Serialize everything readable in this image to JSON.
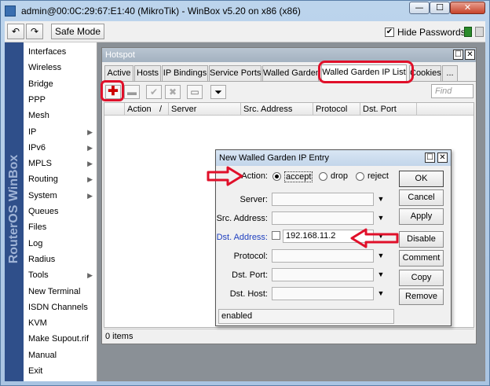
{
  "window": {
    "title": "admin@00:0C:29:67:E1:40 (MikroTik) - WinBox v5.20 on x86 (x86)",
    "minimize_glyph": "—",
    "maximize_glyph": "☐",
    "close_glyph": "✕"
  },
  "toolbar": {
    "undo_glyph": "↶",
    "redo_glyph": "↷",
    "safe_mode_label": "Safe Mode",
    "hide_passwords_label": "Hide Passwords",
    "hide_passwords_checked": "✔"
  },
  "brand": {
    "text": "RouterOS WinBox"
  },
  "sidebar": {
    "items": [
      {
        "label": "Interfaces",
        "arrow": ""
      },
      {
        "label": "Wireless",
        "arrow": ""
      },
      {
        "label": "Bridge",
        "arrow": ""
      },
      {
        "label": "PPP",
        "arrow": ""
      },
      {
        "label": "Mesh",
        "arrow": ""
      },
      {
        "label": "IP",
        "arrow": "▶"
      },
      {
        "label": "IPv6",
        "arrow": "▶"
      },
      {
        "label": "MPLS",
        "arrow": "▶"
      },
      {
        "label": "Routing",
        "arrow": "▶"
      },
      {
        "label": "System",
        "arrow": "▶"
      },
      {
        "label": "Queues",
        "arrow": ""
      },
      {
        "label": "Files",
        "arrow": ""
      },
      {
        "label": "Log",
        "arrow": ""
      },
      {
        "label": "Radius",
        "arrow": ""
      },
      {
        "label": "Tools",
        "arrow": "▶"
      },
      {
        "label": "New Terminal",
        "arrow": ""
      },
      {
        "label": "ISDN Channels",
        "arrow": ""
      },
      {
        "label": "KVM",
        "arrow": ""
      },
      {
        "label": "Make Supout.rif",
        "arrow": ""
      },
      {
        "label": "Manual",
        "arrow": ""
      },
      {
        "label": "Exit",
        "arrow": ""
      }
    ]
  },
  "hotspot": {
    "title": "Hotspot",
    "tabs": [
      "Active",
      "Hosts",
      "IP Bindings",
      "Service Ports",
      "Walled Garden",
      "Walled Garden IP List",
      "Cookies",
      "..."
    ],
    "active_tab": "Walled Garden IP List",
    "find_placeholder": "Find",
    "columns": [
      "",
      "Action",
      "/",
      "Server",
      "Src. Address",
      "Protocol",
      "Dst. Port"
    ],
    "status": "0 items",
    "icons": {
      "add": "✚",
      "remove": "▬",
      "enable": "✔",
      "disable": "✖",
      "comment": "▭",
      "filter": "⏷"
    }
  },
  "dialog": {
    "title": "New Walled Garden IP Entry",
    "action_label": "Action:",
    "action_options": [
      "accept",
      "drop",
      "reject"
    ],
    "action_selected": "accept",
    "fields": {
      "server": {
        "label": "Server:",
        "value": ""
      },
      "src_address": {
        "label": "Src. Address:",
        "value": ""
      },
      "dst_address": {
        "label": "Dst. Address:",
        "value": "192.168.11.2"
      },
      "protocol": {
        "label": "Protocol:",
        "value": ""
      },
      "dst_port": {
        "label": "Dst. Port:",
        "value": ""
      },
      "dst_host": {
        "label": "Dst. Host:",
        "value": ""
      }
    },
    "buttons": [
      "OK",
      "Cancel",
      "Apply",
      "Disable",
      "Comment",
      "Copy",
      "Remove"
    ],
    "status": "enabled"
  },
  "colors": {
    "annotation_red": "#e0102a",
    "brand_blue": "#2f4f8a",
    "dst_address_label": "#1e3fbf"
  }
}
